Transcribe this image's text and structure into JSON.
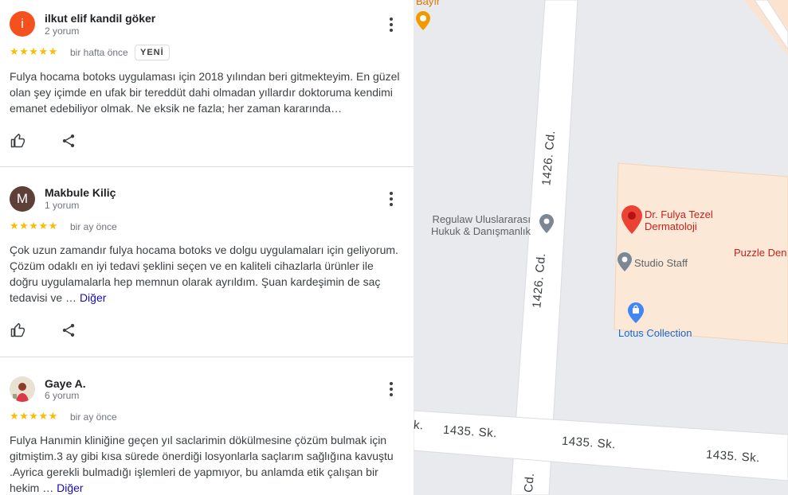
{
  "reviews": [
    {
      "avatar_letter": "i",
      "avatar_color": "#f4511e",
      "name": "ilkut elif kandil göker",
      "count": "2 yorum",
      "stars": "★★★★★",
      "date": "bir hafta önce",
      "badge": "YENİ",
      "lines": [
        "Fulya hocama botoks uygulaması için 2018 yılından beri gitmekteyim. En güzel",
        "olan şey içimde en ufak bir tereddüt dahi olmadan yıllardır doktoruma kendimi",
        "emanet edebiliyor olmak. Ne eksik ne fazla; her zaman kararında…"
      ]
    },
    {
      "avatar_letter": "M",
      "avatar_color": "#5d4037",
      "name": "Makbule Kiliç",
      "count": "1 yorum",
      "stars": "★★★★★",
      "date": "bir ay önce",
      "lines": [
        "Çok uzun zamandır fulya hocama botoks ve dolgu uygulamaları için geliyorum.",
        "Çözüm odaklı en iyi tedavi şeklini seçen ve en kaliteli cihazlarla ürünler ile",
        "doğru uygulamalarla hep memnun olarak ayrıldım. Şuan kardeşimin de saç"
      ],
      "last_line": "tedavisi ve …",
      "more": "Diğer"
    },
    {
      "name": "Gaye A.",
      "count": "6 yorum",
      "stars": "★★★★★",
      "date": "bir ay önce",
      "lines": [
        "Fulya Hanımin kliniğine geçen yıl saclarimin dökülmesine çözüm bulmak için",
        "gitmiştim.3 ay gibi kısa sürede önerdiği losyonlarla saçlarım sağlığına kavuştu",
        ".Ayrica gerekli bulmadığı işlemleri de yapmıyor, bu anlamda etik çalışan bir"
      ],
      "last_line": "hekim …",
      "more": "Diğer"
    }
  ],
  "map": {
    "places": {
      "bayir": "Bayır",
      "regulaw_1": "Regulaw Uluslararası",
      "regulaw_2": "Hukuk & Danışmanlık",
      "dr_fulya_1": "Dr. Fulya Tezel",
      "dr_fulya_2": "Dermatoloji",
      "studio_staff": "Studio Staff",
      "puzzle": "Puzzle Den",
      "lotus": "Lotus Collection"
    },
    "streets": {
      "cd_1426_top": "1426. Cd.",
      "cd_1426_mid": "1426. Cd.",
      "cd_bottom": "Cd.",
      "sk_1435_a": "1435. Sk.",
      "sk_1435_b": "1435. Sk.",
      "sk_1435_c": "1435. Sk.",
      "sk_edge": "k."
    }
  },
  "colors": {
    "star": "#fbbc04",
    "link": "#1a0dab",
    "pin_red": "#ea4335",
    "pin_gray": "#70757a",
    "label_red": "#c5221f",
    "label_blue": "#1967d2",
    "label_gray": "#5f6368",
    "orange": "#f29900"
  }
}
